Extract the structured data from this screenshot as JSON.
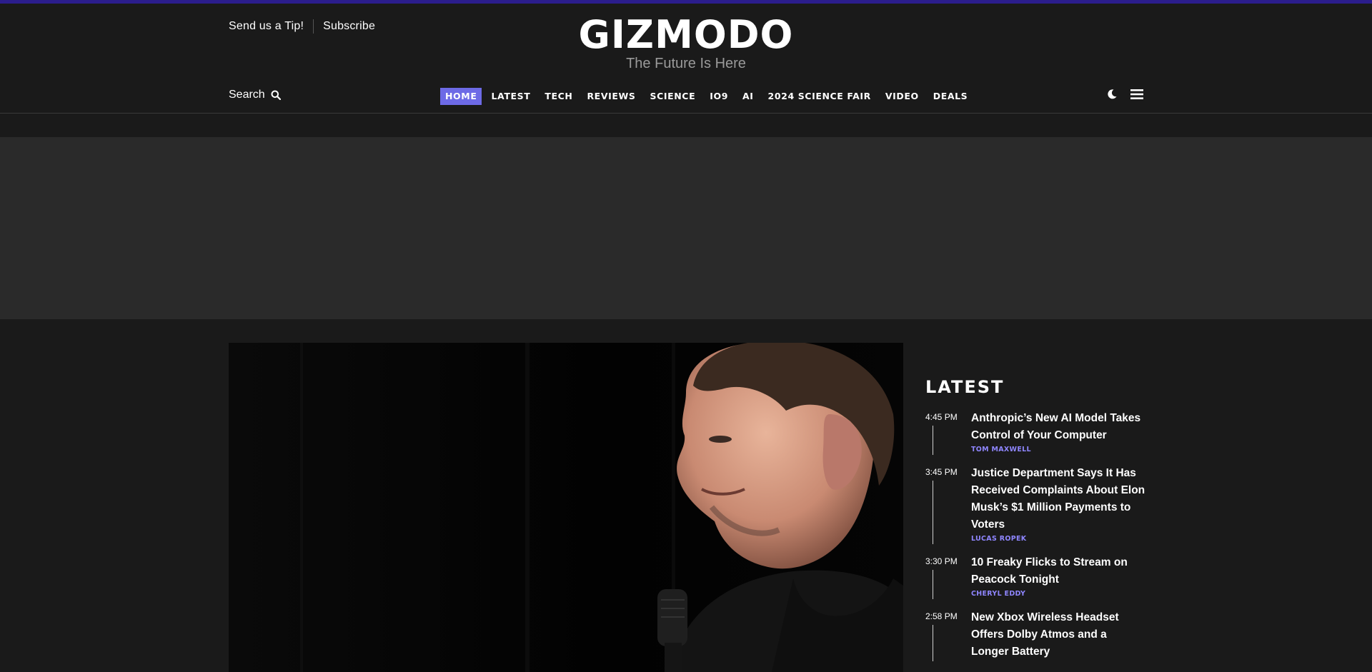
{
  "header": {
    "tip_label": "Send us a Tip!",
    "subscribe_label": "Subscribe",
    "logo_text": "GIZMODO",
    "tagline": "The Future Is Here",
    "search_label": "Search",
    "accent_color": "#6d6ae6",
    "top_strip_color": "#2b1d8c",
    "icons": [
      "search-icon",
      "dark-mode-moon-icon",
      "hamburger-menu-icon"
    ]
  },
  "nav": {
    "items": [
      {
        "label": "HOME",
        "active": true
      },
      {
        "label": "LATEST"
      },
      {
        "label": "TECH"
      },
      {
        "label": "REVIEWS"
      },
      {
        "label": "SCIENCE"
      },
      {
        "label": "IO9"
      },
      {
        "label": "AI"
      },
      {
        "label": "2024 SCIENCE FAIR"
      },
      {
        "label": "VIDEO"
      },
      {
        "label": "DEALS"
      }
    ]
  },
  "latest": {
    "title": "LATEST",
    "items": [
      {
        "time": "4:45 PM",
        "headline": "Anthropic’s New AI Model Takes Control of Your Computer",
        "author": "TOM MAXWELL"
      },
      {
        "time": "3:45 PM",
        "headline": "Justice Department Says It Has Received Complaints About Elon Musk’s $1 Million Payments to Voters",
        "author": "LUCAS ROPEK"
      },
      {
        "time": "3:30 PM",
        "headline": "10 Freaky Flicks to Stream on Peacock Tonight",
        "author": "CHERYL EDDY"
      },
      {
        "time": "2:58 PM",
        "headline": "New Xbox Wireless Headset Offers Dolby Atmos and a Longer Battery",
        "author": ""
      }
    ]
  }
}
